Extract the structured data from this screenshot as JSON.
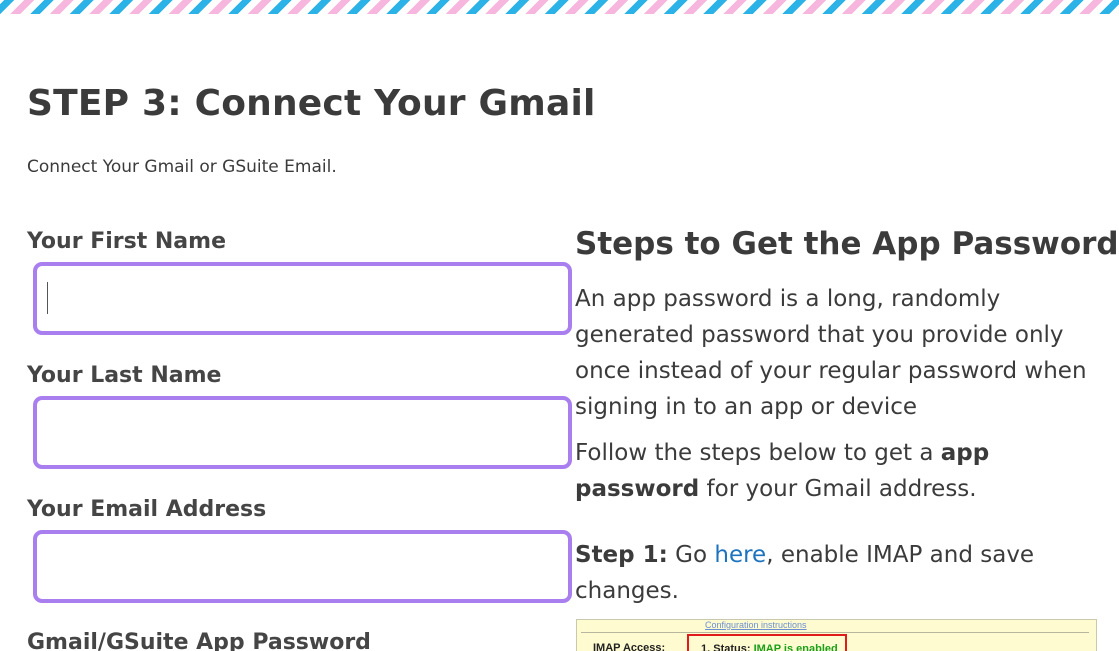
{
  "page": {
    "title": "STEP 3: Connect Your Gmail",
    "subtitle": "Connect Your Gmail or GSuite Email."
  },
  "form": {
    "first_name_label": "Your First Name",
    "first_name_value": "",
    "last_name_label": "Your Last Name",
    "last_name_value": "",
    "email_label": "Your Email Address",
    "email_value": "",
    "app_password_label": "Gmail/GSuite App Password"
  },
  "instructions": {
    "title": "Steps to Get the App Password",
    "intro": "An app password is a long, randomly generated password that you provide only once instead of your regular password when signing in to an app or device",
    "follow_prefix": "Follow the steps below to get a ",
    "follow_bold_1": "app",
    "follow_bold_2": "password",
    "follow_suffix": " for your Gmail address.",
    "step1_label": "Step 1:",
    "step1_prefix": " Go ",
    "step1_link": "here",
    "step1_suffix": ", enable IMAP and save changes."
  },
  "thumbnail": {
    "caption": "Configuration instructions",
    "row_label": "IMAP Access:",
    "status_prefix": "1. Status: ",
    "status_value": "IMAP is enabled"
  },
  "colors": {
    "input_border": "#a97ff0",
    "link": "#1e73be",
    "stripe_blue": "#2bb3e8",
    "stripe_pink": "#f7b6dd"
  }
}
